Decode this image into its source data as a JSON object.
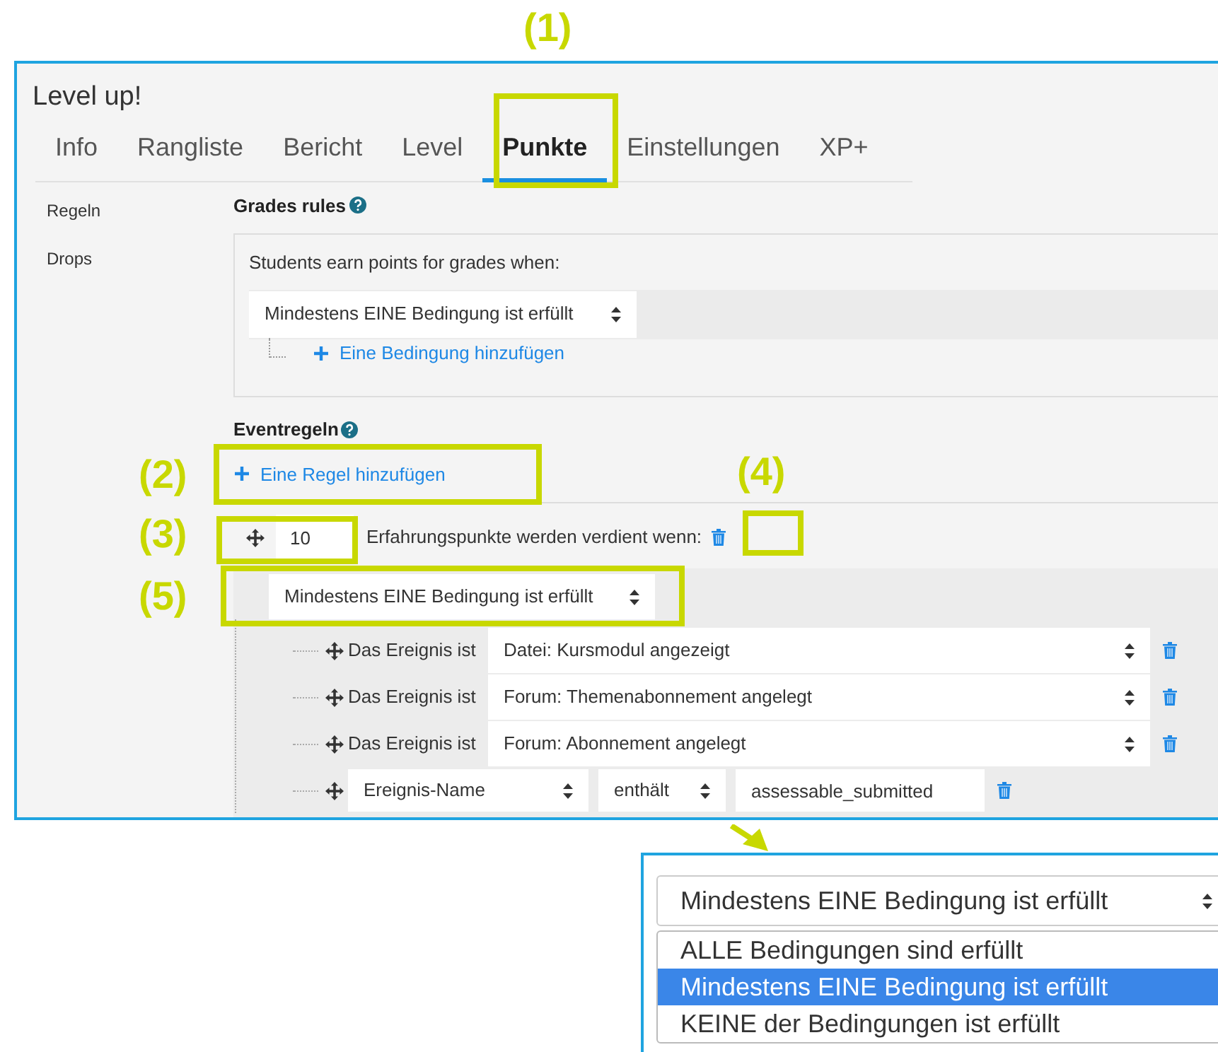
{
  "window": {
    "title": "Level up!"
  },
  "tabs": [
    {
      "label": "Info",
      "selected": false
    },
    {
      "label": "Rangliste",
      "selected": false
    },
    {
      "label": "Bericht",
      "selected": false
    },
    {
      "label": "Level",
      "selected": false
    },
    {
      "label": "Punkte",
      "selected": true
    },
    {
      "label": "Einstellungen",
      "selected": false
    },
    {
      "label": "XP+",
      "selected": false
    }
  ],
  "sidebar": {
    "items": [
      {
        "label": "Regeln"
      },
      {
        "label": "Drops"
      }
    ]
  },
  "grades_rules": {
    "heading": "Grades rules",
    "intro": "Students earn points for grades when:",
    "match": "Mindestens EINE Bedingung ist erfüllt",
    "add_condition": "Eine Bedingung hinzufügen"
  },
  "event_rules": {
    "heading": "Eventregeln",
    "add_rule": "Eine Regel hinzufügen",
    "rule": {
      "points": "10",
      "label": "Erfahrungspunkte werden verdient wenn:",
      "match": "Mindestens EINE Bedingung ist erfüllt",
      "conditions": [
        {
          "kind": "event",
          "label": "Das Ereignis ist",
          "event": "Datei: Kursmodul angezeigt"
        },
        {
          "kind": "event",
          "label": "Das Ereignis ist",
          "event": "Forum: Themenabonnement angelegt"
        },
        {
          "kind": "event",
          "label": "Das Ereignis ist",
          "event": "Forum: Abonnement angelegt"
        },
        {
          "kind": "property",
          "property": "Ereignis-Name",
          "operator": "enthält",
          "value": "assessable_submitted"
        }
      ]
    }
  },
  "annotations": [
    {
      "label": "(1)"
    },
    {
      "label": "(2)"
    },
    {
      "label": "(3)"
    },
    {
      "label": "(4)"
    },
    {
      "label": "(5)"
    }
  ],
  "inset": {
    "value": "Mindestens EINE Bedingung ist erfüllt",
    "options": [
      {
        "label": "ALLE Bedingungen sind erfüllt",
        "selected": false
      },
      {
        "label": "Mindestens EINE Bedingung ist erfüllt",
        "selected": true
      },
      {
        "label": "KEINE der Bedingungen ist erfüllt",
        "selected": false
      }
    ]
  }
}
